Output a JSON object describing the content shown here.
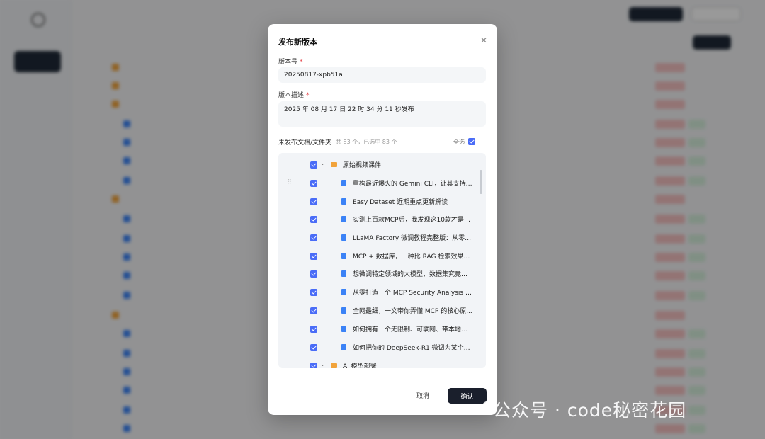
{
  "modal": {
    "title": "发布新版本",
    "close_icon": "close-icon",
    "version_label": "版本号",
    "version_value": "20250817-xpb51a",
    "desc_label": "版本描述",
    "desc_value": "2025 年 08 月 17 日 22 时 34 分 11 秒发布",
    "required_mark": "*",
    "unpublished_label": "未发布文档/文件夹",
    "count_text": "共 83 个，已选中 83 个",
    "select_all_label": "全选",
    "tree": [
      {
        "type": "folder",
        "name": "原始视频课件",
        "checked": true,
        "expanded": true
      },
      {
        "type": "doc",
        "name": "重构最近爆火的 Gemini CLI，让其支持运...",
        "checked": true
      },
      {
        "type": "doc",
        "name": "Easy Dataset 近期重点更新解读",
        "checked": true
      },
      {
        "type": "doc",
        "name": "实测上百款MCP后，我发现这10款才是真...",
        "checked": true
      },
      {
        "type": "doc",
        "name": "LLaMA Factory 微调教程完整版：从零微...",
        "checked": true
      },
      {
        "type": "doc",
        "name": "MCP + 数据库，一种比 RAG 检索效果更...",
        "checked": true
      },
      {
        "type": "doc",
        "name": "想微调特定领域的大模型，数据集究竟要...",
        "checked": true
      },
      {
        "type": "doc",
        "name": "从零打造一个 MCP Security Analysis Mult...",
        "checked": true
      },
      {
        "type": "doc",
        "name": "全网最细，一文带你弄懂 MCP 的核心原...",
        "checked": true
      },
      {
        "type": "doc",
        "name": "如何拥有一个无限制、可联网、带本地知...",
        "checked": true
      },
      {
        "type": "doc",
        "name": "如何把你的 DeepSeek-R1 微调为某个领...",
        "checked": true
      },
      {
        "type": "folder",
        "name": "AI 模型部署",
        "checked": true,
        "expanded": true
      }
    ],
    "cancel_label": "取消",
    "confirm_label": "确认"
  },
  "watermark": "公众号 · code秘密花园",
  "colors": {
    "accent_checkbox": "#4a6cf7",
    "primary_button": "#1a1f2c",
    "folder": "#f1a33b",
    "doc": "#3b82f6",
    "required": "#e5484d"
  }
}
